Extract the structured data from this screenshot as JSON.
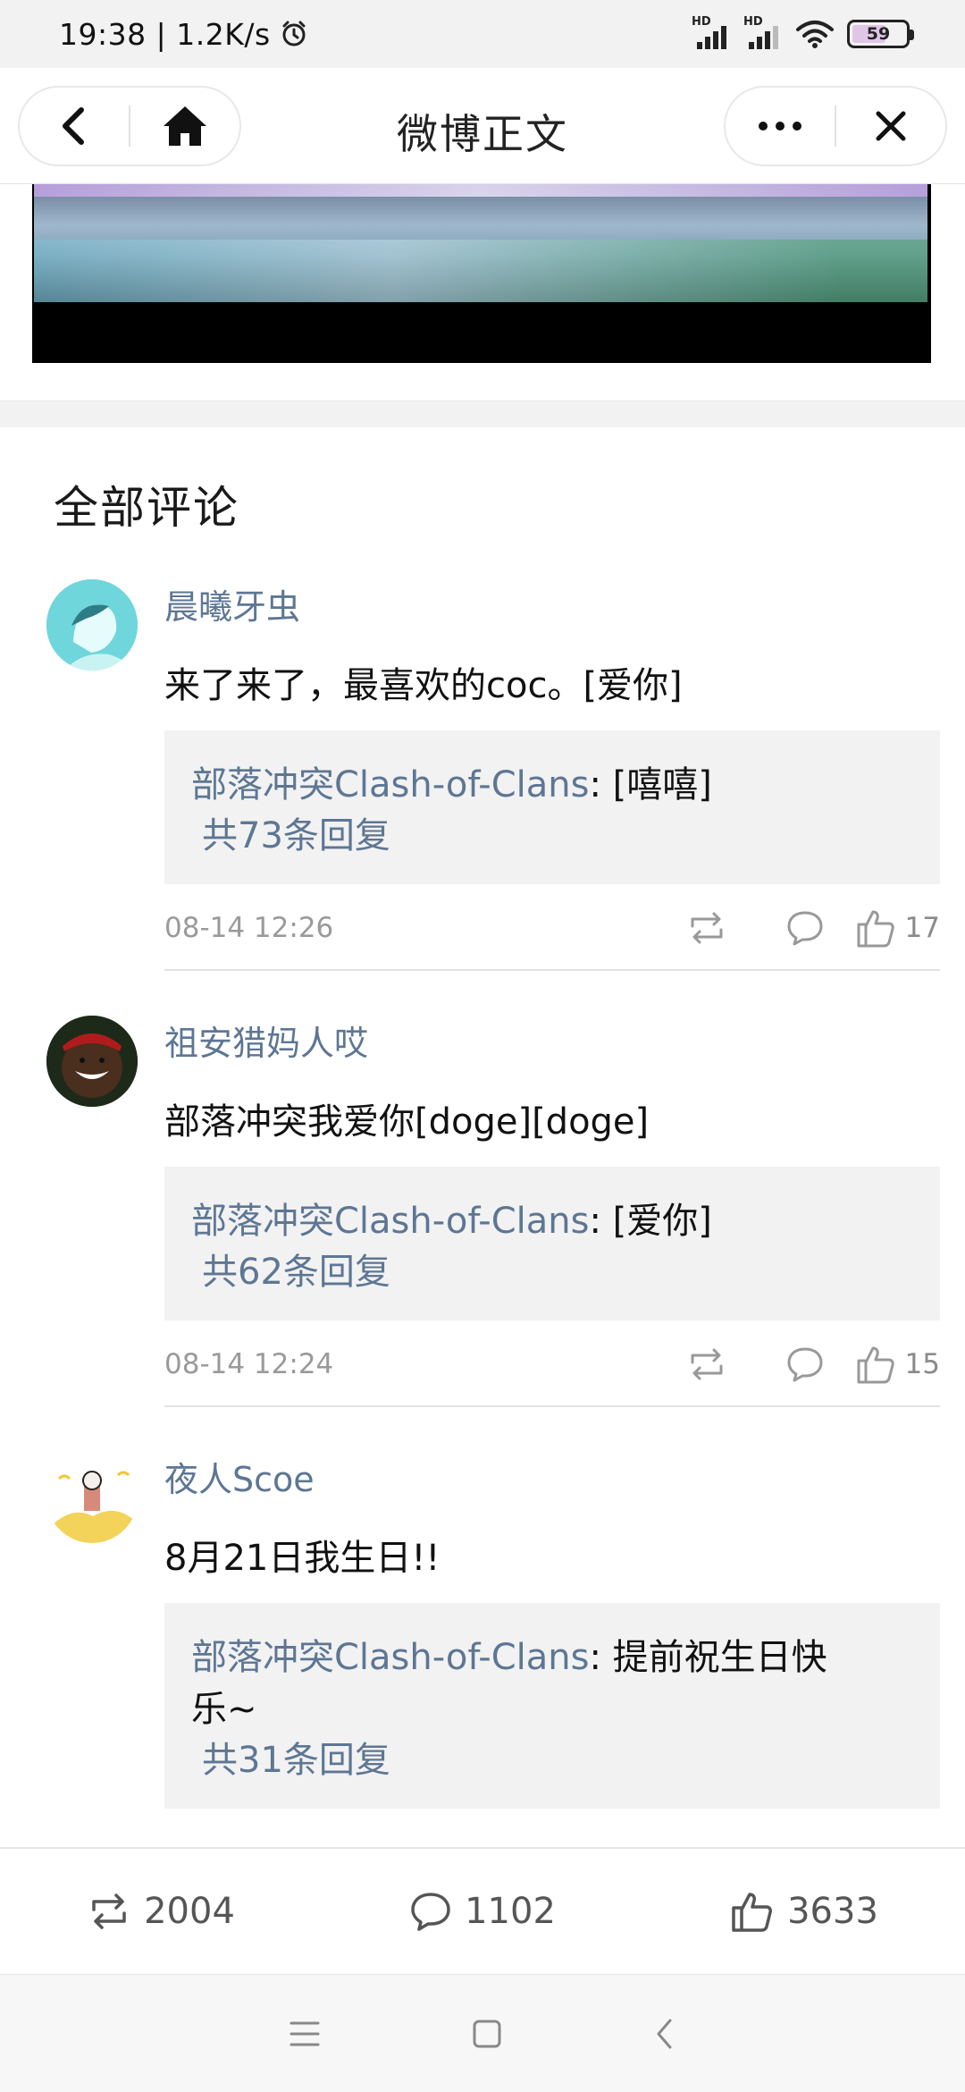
{
  "status_bar": {
    "time": "19:38",
    "speed": "1.2K/s",
    "sim1_label": "HD",
    "sim2_label": "HD",
    "battery": "59"
  },
  "header": {
    "title": "微博正文"
  },
  "comments_section": {
    "title": "全部评论",
    "comments": [
      {
        "username": "晨曦牙虫",
        "text": "来了来了，最喜欢的coc。[爱你]",
        "reply_author": "部落冲突Clash-of-Clans",
        "reply_text": ": [嘻嘻]",
        "reply_count": "共73条回复",
        "time": "08-14 12:26",
        "likes": "17"
      },
      {
        "username": "祖安猎妈人哎",
        "text": "部落冲突我爱你[doge][doge]",
        "reply_author": "部落冲突Clash-of-Clans",
        "reply_text": ": [爱你]",
        "reply_count": "共62条回复",
        "time": "08-14 12:24",
        "likes": "15"
      },
      {
        "username": "夜人Scoe",
        "text": "8月21日我生日!!",
        "reply_author": "部落冲突Clash-of-Clans",
        "reply_text": ": 提前祝生日快",
        "reply_text_2": "乐~",
        "reply_count": "共31条回复"
      }
    ]
  },
  "action_bar": {
    "reposts": "2004",
    "comments": "1102",
    "likes": "3633"
  },
  "colors": {
    "link": "#5d7694",
    "reply_bg": "#f2f2f2",
    "muted": "#9a9a9a"
  }
}
